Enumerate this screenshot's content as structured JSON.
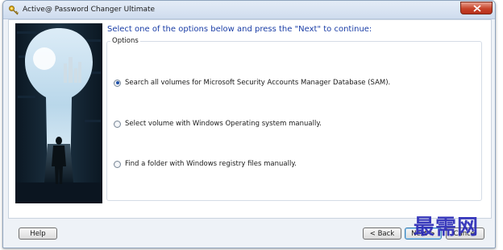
{
  "window": {
    "title": "Active@ Password Changer Ultimate"
  },
  "page": {
    "heading": "Select one of the options below and press the \"Next\" to continue:",
    "group_label": "Options",
    "options": [
      {
        "label": "Search all volumes for Microsoft Security Accounts Manager Database (SAM).",
        "selected": true
      },
      {
        "label": "Select volume with Windows Operating system manually.",
        "selected": false
      },
      {
        "label": "Find a folder with Windows registry files manually.",
        "selected": false
      }
    ]
  },
  "buttons": {
    "help": "Help",
    "back": "< Back",
    "next": "Next >",
    "cancel": "Cancel"
  },
  "watermark": "最需网",
  "colors": {
    "heading": "#1a3da6",
    "close_button": "#c7432a",
    "watermark": "#2b2bb8"
  },
  "icons": [
    "app-key-icon",
    "close-icon",
    "radio-icon"
  ]
}
